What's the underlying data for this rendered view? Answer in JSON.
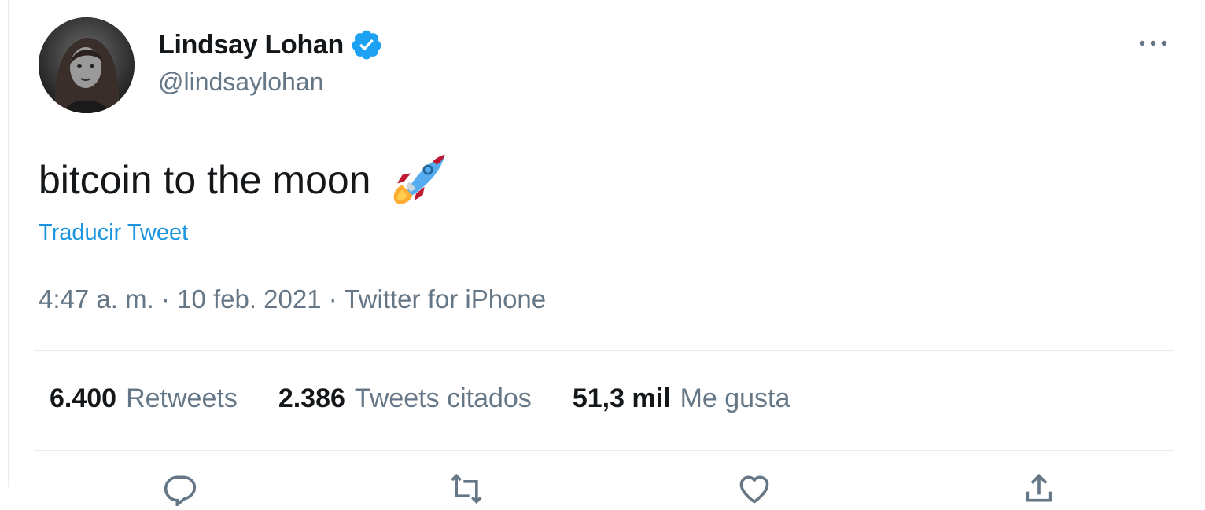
{
  "user": {
    "display_name": "Lindsay Lohan",
    "handle": "@lindsaylohan",
    "verified_icon": "verified-badge-icon",
    "avatar": "avatar"
  },
  "tweet": {
    "text": "bitcoin to the moon",
    "emoji": "rocket-icon",
    "translate_label": "Traducir Tweet",
    "time": "4:47 a. m.",
    "separator": "·",
    "date": "10 feb. 2021",
    "source": "Twitter for iPhone"
  },
  "stats": [
    {
      "value": "6.400",
      "label": "Retweets"
    },
    {
      "value": "2.386",
      "label": "Tweets citados"
    },
    {
      "value": "51,3 mil",
      "label": "Me gusta"
    }
  ],
  "colors": {
    "accent": "#1b95e0",
    "text": "#14171a",
    "muted": "#657786",
    "verified": "#1da1f2"
  },
  "icons": [
    "more-options-icon",
    "reply-icon",
    "retweet-icon",
    "like-icon",
    "share-icon"
  ]
}
